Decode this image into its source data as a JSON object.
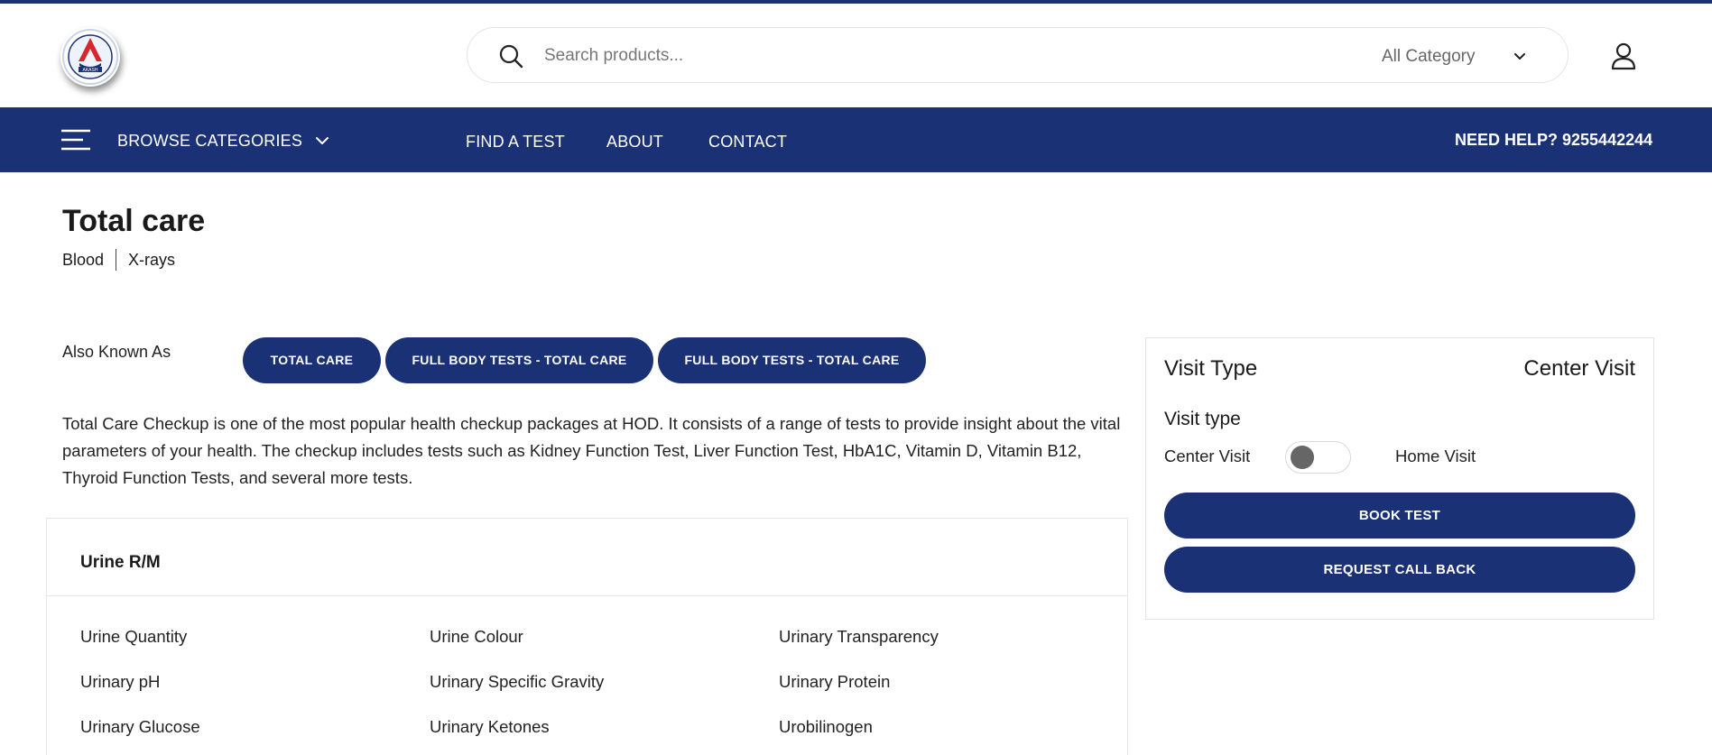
{
  "colors": {
    "brand": "#1b3175",
    "white": "#ffffff"
  },
  "header": {
    "logo_text": "AKASH",
    "search": {
      "placeholder": "Search products...",
      "category": "All Category"
    }
  },
  "nav": {
    "browse_label": "BROWSE CATEGORIES",
    "links": [
      "FIND A TEST",
      "ABOUT",
      "CONTACT"
    ],
    "help": "NEED HELP? 9255442244"
  },
  "product": {
    "title": "Total care",
    "tags": [
      "Blood",
      "X-rays"
    ],
    "aka_label": "Also Known As",
    "aka": [
      "TOTAL CARE",
      "FULL BODY TESTS - TOTAL CARE",
      "FULL BODY TESTS - TOTAL CARE"
    ],
    "description": "Total Care Checkup is one of the most popular health checkup packages at HOD. It consists of a range of tests to provide insight about the vital parameters of your health. The checkup includes tests such as Kidney Function Test, Liver Function Test, HbA1C, Vitamin D, Vitamin B12, Thyroid Function Tests, and several more tests."
  },
  "test_group": {
    "name": "Urine R/M",
    "items": [
      "Urine Quantity",
      "Urine Colour",
      "Urinary Transparency",
      "Urinary pH",
      "Urinary Specific Gravity",
      "Urinary Protein",
      "Urinary Glucose",
      "Urinary Ketones",
      "Urobilinogen"
    ]
  },
  "visit_card": {
    "title": "Visit Type",
    "selected": "Center Visit",
    "subtitle": "Visit type",
    "option_left": "Center Visit",
    "option_right": "Home Visit",
    "book_label": "BOOK TEST",
    "callback_label": "REQUEST CALL BACK"
  }
}
